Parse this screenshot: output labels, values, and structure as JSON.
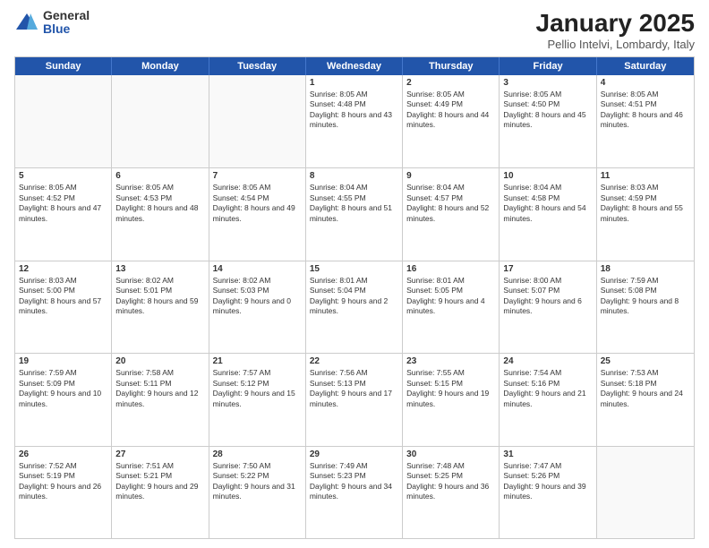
{
  "logo": {
    "general": "General",
    "blue": "Blue"
  },
  "header": {
    "title": "January 2025",
    "subtitle": "Pellio Intelvi, Lombardy, Italy"
  },
  "weekdays": [
    "Sunday",
    "Monday",
    "Tuesday",
    "Wednesday",
    "Thursday",
    "Friday",
    "Saturday"
  ],
  "weeks": [
    [
      {
        "day": "",
        "empty": true
      },
      {
        "day": "",
        "empty": true
      },
      {
        "day": "",
        "empty": true
      },
      {
        "day": "1",
        "sunrise": "8:05 AM",
        "sunset": "4:48 PM",
        "daylight": "8 hours and 43 minutes."
      },
      {
        "day": "2",
        "sunrise": "8:05 AM",
        "sunset": "4:49 PM",
        "daylight": "8 hours and 44 minutes."
      },
      {
        "day": "3",
        "sunrise": "8:05 AM",
        "sunset": "4:50 PM",
        "daylight": "8 hours and 45 minutes."
      },
      {
        "day": "4",
        "sunrise": "8:05 AM",
        "sunset": "4:51 PM",
        "daylight": "8 hours and 46 minutes."
      }
    ],
    [
      {
        "day": "5",
        "sunrise": "8:05 AM",
        "sunset": "4:52 PM",
        "daylight": "8 hours and 47 minutes."
      },
      {
        "day": "6",
        "sunrise": "8:05 AM",
        "sunset": "4:53 PM",
        "daylight": "8 hours and 48 minutes."
      },
      {
        "day": "7",
        "sunrise": "8:05 AM",
        "sunset": "4:54 PM",
        "daylight": "8 hours and 49 minutes."
      },
      {
        "day": "8",
        "sunrise": "8:04 AM",
        "sunset": "4:55 PM",
        "daylight": "8 hours and 51 minutes."
      },
      {
        "day": "9",
        "sunrise": "8:04 AM",
        "sunset": "4:57 PM",
        "daylight": "8 hours and 52 minutes."
      },
      {
        "day": "10",
        "sunrise": "8:04 AM",
        "sunset": "4:58 PM",
        "daylight": "8 hours and 54 minutes."
      },
      {
        "day": "11",
        "sunrise": "8:03 AM",
        "sunset": "4:59 PM",
        "daylight": "8 hours and 55 minutes."
      }
    ],
    [
      {
        "day": "12",
        "sunrise": "8:03 AM",
        "sunset": "5:00 PM",
        "daylight": "8 hours and 57 minutes."
      },
      {
        "day": "13",
        "sunrise": "8:02 AM",
        "sunset": "5:01 PM",
        "daylight": "8 hours and 59 minutes."
      },
      {
        "day": "14",
        "sunrise": "8:02 AM",
        "sunset": "5:03 PM",
        "daylight": "9 hours and 0 minutes."
      },
      {
        "day": "15",
        "sunrise": "8:01 AM",
        "sunset": "5:04 PM",
        "daylight": "9 hours and 2 minutes."
      },
      {
        "day": "16",
        "sunrise": "8:01 AM",
        "sunset": "5:05 PM",
        "daylight": "9 hours and 4 minutes."
      },
      {
        "day": "17",
        "sunrise": "8:00 AM",
        "sunset": "5:07 PM",
        "daylight": "9 hours and 6 minutes."
      },
      {
        "day": "18",
        "sunrise": "7:59 AM",
        "sunset": "5:08 PM",
        "daylight": "9 hours and 8 minutes."
      }
    ],
    [
      {
        "day": "19",
        "sunrise": "7:59 AM",
        "sunset": "5:09 PM",
        "daylight": "9 hours and 10 minutes."
      },
      {
        "day": "20",
        "sunrise": "7:58 AM",
        "sunset": "5:11 PM",
        "daylight": "9 hours and 12 minutes."
      },
      {
        "day": "21",
        "sunrise": "7:57 AM",
        "sunset": "5:12 PM",
        "daylight": "9 hours and 15 minutes."
      },
      {
        "day": "22",
        "sunrise": "7:56 AM",
        "sunset": "5:13 PM",
        "daylight": "9 hours and 17 minutes."
      },
      {
        "day": "23",
        "sunrise": "7:55 AM",
        "sunset": "5:15 PM",
        "daylight": "9 hours and 19 minutes."
      },
      {
        "day": "24",
        "sunrise": "7:54 AM",
        "sunset": "5:16 PM",
        "daylight": "9 hours and 21 minutes."
      },
      {
        "day": "25",
        "sunrise": "7:53 AM",
        "sunset": "5:18 PM",
        "daylight": "9 hours and 24 minutes."
      }
    ],
    [
      {
        "day": "26",
        "sunrise": "7:52 AM",
        "sunset": "5:19 PM",
        "daylight": "9 hours and 26 minutes."
      },
      {
        "day": "27",
        "sunrise": "7:51 AM",
        "sunset": "5:21 PM",
        "daylight": "9 hours and 29 minutes."
      },
      {
        "day": "28",
        "sunrise": "7:50 AM",
        "sunset": "5:22 PM",
        "daylight": "9 hours and 31 minutes."
      },
      {
        "day": "29",
        "sunrise": "7:49 AM",
        "sunset": "5:23 PM",
        "daylight": "9 hours and 34 minutes."
      },
      {
        "day": "30",
        "sunrise": "7:48 AM",
        "sunset": "5:25 PM",
        "daylight": "9 hours and 36 minutes."
      },
      {
        "day": "31",
        "sunrise": "7:47 AM",
        "sunset": "5:26 PM",
        "daylight": "9 hours and 39 minutes."
      },
      {
        "day": "",
        "empty": true
      }
    ]
  ]
}
